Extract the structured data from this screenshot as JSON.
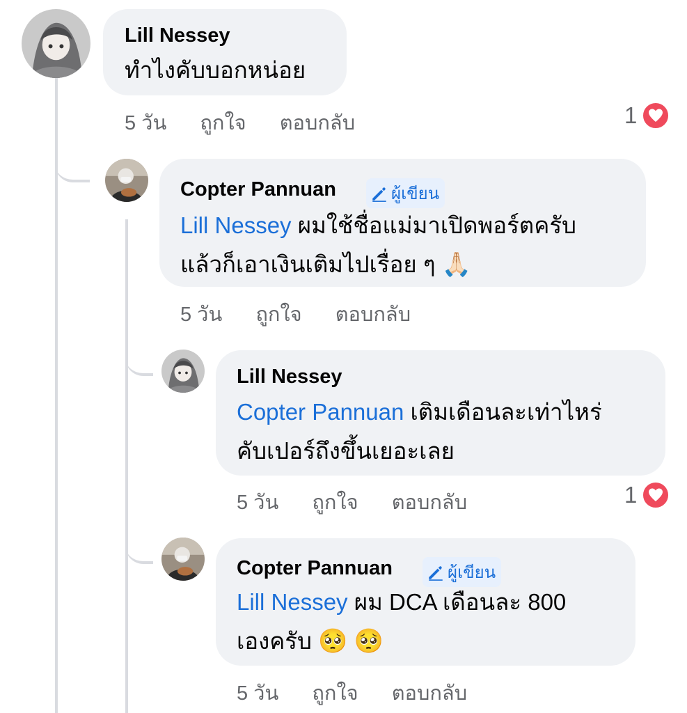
{
  "comments": [
    {
      "author": "Lill Nessey",
      "text": "ทำไงคับบอกหน่อย",
      "time": "5 วัน",
      "like": "ถูกใจ",
      "reply": "ตอบกลับ",
      "reactions": "1"
    },
    {
      "author": "Copter Pannuan",
      "badge": "ผู้เขียน",
      "mention": "Lill Nessey",
      "line1": " ผมใช้ชื่อแม่มาเปิดพอร์ตครับ",
      "line2": "แล้วก็เอาเงินเติมไปเรื่อย ๆ",
      "emoji": "🙏🏻",
      "time": "5 วัน",
      "like": "ถูกใจ",
      "reply": "ตอบกลับ"
    },
    {
      "author": "Lill Nessey",
      "mention": "Copter Pannuan",
      "line1": " เติมเดือนละเท่าไหร่",
      "line2": "คับเปอร์ถึงขึ้นเยอะเลย",
      "time": "5 วัน",
      "like": "ถูกใจ",
      "reply": "ตอบกลับ",
      "reactions": "1"
    },
    {
      "author": "Copter Pannuan",
      "badge": "ผู้เขียน",
      "mention": "Lill Nessey",
      "line1": " ผม DCA เดือนละ 800",
      "line2": "เองครับ",
      "emoji": "🥺 🥺",
      "time": "5 วัน",
      "like": "ถูกใจ",
      "reply": "ตอบกลับ"
    }
  ],
  "colors": {
    "bubble": "#f0f2f5",
    "mention": "#1b6fd8",
    "meta": "#65676b",
    "heart": "#ef4a5c"
  },
  "icons": {
    "heart": "heart-icon",
    "pencil": "pencil-icon"
  }
}
